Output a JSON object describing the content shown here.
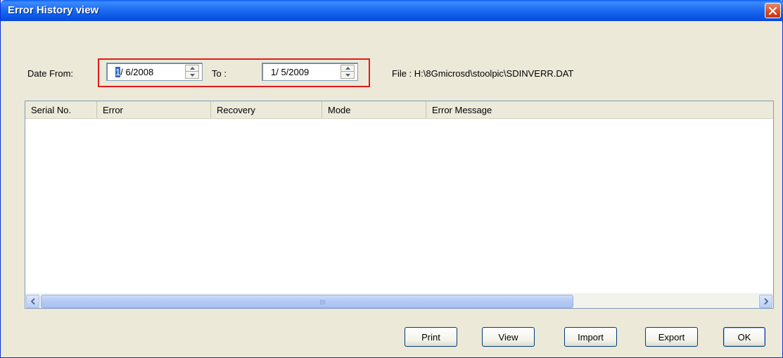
{
  "window": {
    "title": "Error History view"
  },
  "filters": {
    "date_from_label": "Date From:",
    "date_from_month": "1",
    "date_from_rest": "/ 6/2008",
    "to_label": "To :",
    "date_to_value": "1/ 5/2009",
    "file_label": "File : H:\\8Gmicrosd\\stoolpic\\SDINVERR.DAT"
  },
  "table": {
    "columns": [
      "Serial No.",
      "Error",
      "Recovery",
      "Mode",
      "Error Message"
    ],
    "rows": []
  },
  "buttons": {
    "print": "Print",
    "view": "View",
    "import": "Import",
    "export": "Export",
    "ok": "OK"
  },
  "icons": {
    "close": "close-icon",
    "spin_up": "spin-up-icon",
    "spin_down": "spin-down-icon",
    "scroll_left": "scroll-left-arrow-icon",
    "scroll_right": "scroll-right-arrow-icon"
  },
  "colors": {
    "title_bar": "#0a5ef5",
    "highlight": "#e21a1a",
    "selection": "#316ac5"
  }
}
